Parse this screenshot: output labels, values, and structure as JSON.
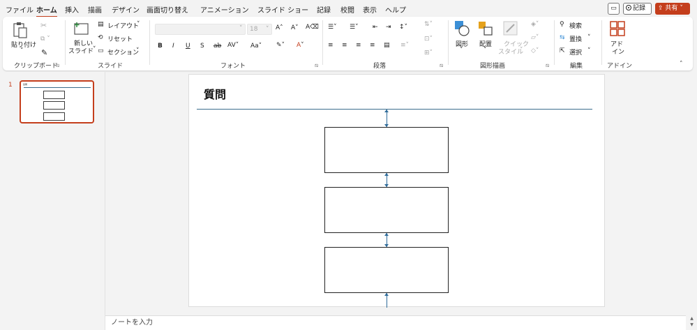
{
  "menu": {
    "tabs": [
      "ファイル",
      "ホーム",
      "挿入",
      "描画",
      "デザイン",
      "画面切り替え",
      "アニメーション",
      "スライド ショー",
      "記録",
      "校閲",
      "表示",
      "ヘルプ"
    ],
    "record_label": "記録",
    "share_label": "共有"
  },
  "ribbon": {
    "clipboard": {
      "paste_label": "貼り付け",
      "group_label": "クリップボード"
    },
    "slides": {
      "new_slide_label": "新しい",
      "new_slide_label2": "スライド",
      "layout_label": "レイアウト",
      "reset_label": "リセット",
      "section_label": "セクション",
      "group_label": "スライド"
    },
    "font": {
      "size_value": "18",
      "group_label": "フォント"
    },
    "paragraph": {
      "group_label": "段落"
    },
    "drawing": {
      "shapes_label": "図形",
      "arrange_label": "配置",
      "quick_styles_label": "クイック",
      "quick_styles_label2": "スタイル",
      "group_label": "図形描画"
    },
    "editing": {
      "find_label": "検索",
      "replace_label": "置換",
      "select_label": "選択",
      "group_label": "編集"
    },
    "addins": {
      "label": "アド",
      "label2": "イン",
      "group_label": "アドイン"
    }
  },
  "thumbnails": {
    "slide_number": "1"
  },
  "slide": {
    "title": "質問"
  },
  "notes": {
    "placeholder": "ノートを入力"
  },
  "colors": {
    "accent": "#c43e1c",
    "connector": "#2e6b99",
    "title_rule": "#3b6d8d"
  }
}
